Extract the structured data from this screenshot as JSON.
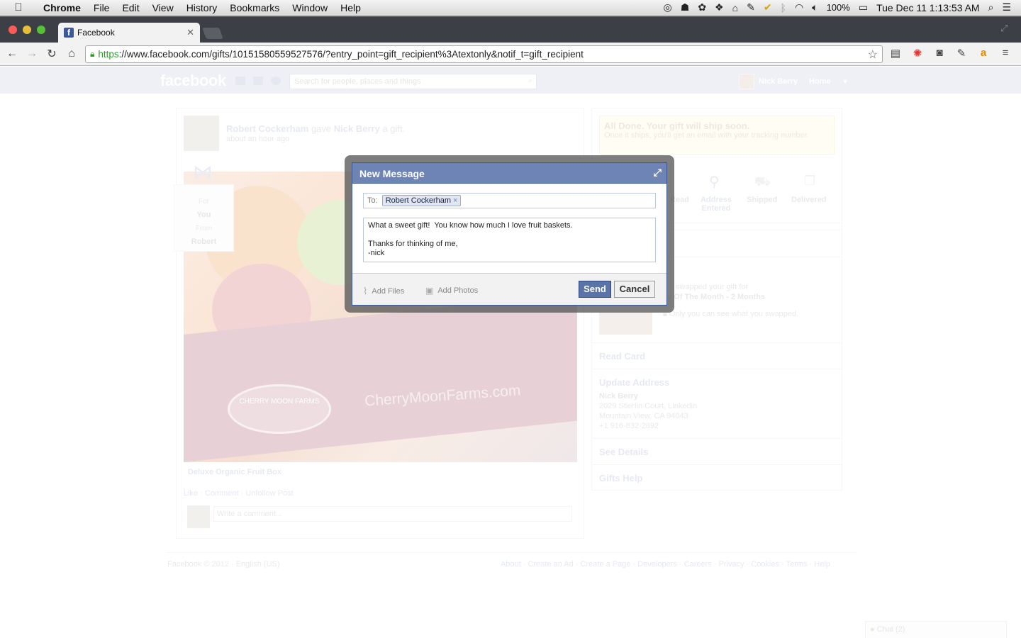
{
  "menubar": {
    "app": "Chrome",
    "menus": [
      "File",
      "Edit",
      "View",
      "History",
      "Bookmarks",
      "Window",
      "Help"
    ],
    "battery": "100%",
    "clock": "Tue Dec 11  1:13:53 AM"
  },
  "browser": {
    "tab_title": "Facebook",
    "url_scheme": "https",
    "url_rest": "://www.facebook.com/gifts/10151580559527576/?entry_point=gift_recipient%3Atextonly&notif_t=gift_recipient"
  },
  "facebook": {
    "logo": "facebook",
    "search_placeholder": "Search for people, places and things",
    "user_name": "Nick Berry",
    "home": "Home",
    "story": {
      "giver": "Robert Cockerham",
      "verb": "gave",
      "recipient": "Nick Berry",
      "tail": "a gift.",
      "time": "about an hour ago",
      "tag_for": "For",
      "tag_you": "You",
      "tag_from": "From",
      "tag_robert": "Robert",
      "photo_brand": "CherryMoonFarms.com",
      "seal_text": "CHERRY MOON FARMS",
      "product": "Deluxe Organic Fruit Box",
      "actions": "Like · Comment · Unfollow Post",
      "comment_placeholder": "Write a comment..."
    },
    "sidebar": {
      "done_title": "All Done. Your gift will ship soon.",
      "done_body": "Once it ships, you'll get an email with your tracking number.",
      "steps": [
        "Read",
        "Address Entered",
        "Shipped",
        "Delivered"
      ],
      "swap_line1": "swapped your gift for",
      "swap_line2": "y Of The Month - 2 Months",
      "swap_note": "Only you can see what you swapped.",
      "read_card": "Read Card",
      "update_address": "Update Address",
      "addr_name": "Nick Berry",
      "addr_street": "2029 Stierlin Court, Linkedin",
      "addr_city": "Mountain View, CA 94043",
      "addr_phone": "+1 916-832-2892",
      "see_details": "See Details",
      "gifts_help": "Gifts Help"
    },
    "footer": {
      "left": "Facebook © 2012 · English (US)",
      "right": "About · Create an Ad · Create a Page · Developers · Careers · Privacy · Cookies · Terms · Help"
    },
    "chat": "Chat (2)"
  },
  "dialog": {
    "title": "New Message",
    "to_label": "To:",
    "to_token": "Robert Cockerham",
    "token_remove": "×",
    "message": "What a sweet gift!  You know how much I love fruit baskets.\n\nThanks for thinking of me,\n-nick",
    "add_files": "Add Files",
    "add_photos": "Add Photos",
    "send": "Send",
    "cancel": "Cancel"
  }
}
